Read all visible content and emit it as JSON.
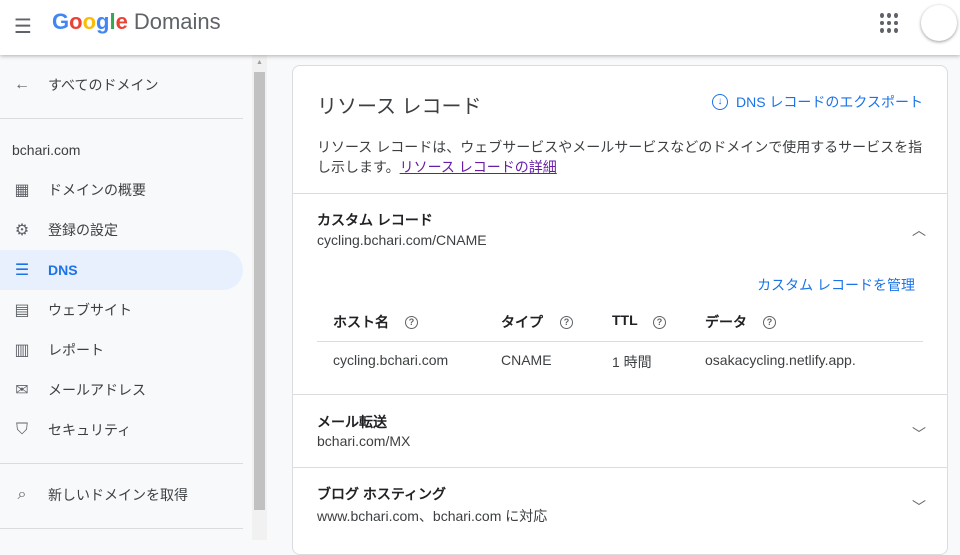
{
  "header": {
    "logo_google": "Google",
    "logo_product": "Domains"
  },
  "sidebar": {
    "back_label": "すべてのドメイン",
    "domain": "bchari.com",
    "items": [
      {
        "label": "ドメインの概要",
        "icon": "dashboard-icon"
      },
      {
        "label": "登録の設定",
        "icon": "gear-icon"
      },
      {
        "label": "DNS",
        "icon": "dns-icon"
      },
      {
        "label": "ウェブサイト",
        "icon": "website-icon"
      },
      {
        "label": "レポート",
        "icon": "chart-icon"
      },
      {
        "label": "メールアドレス",
        "icon": "mail-icon"
      },
      {
        "label": "セキュリティ",
        "icon": "shield-icon"
      }
    ],
    "get_domain_label": "新しいドメインを取得"
  },
  "card": {
    "title": "リソース レコード",
    "export_label": "DNS レコードのエクスポート",
    "description": "リソース レコードは、ウェブサービスやメールサービスなどのドメインで使用するサービスを指し示します。",
    "details_link": "リソース レコードの詳細",
    "sections": [
      {
        "title": "カスタム レコード",
        "subtitle": "cycling.bchari.com/CNAME",
        "manage_label": "カスタム レコードを管理",
        "columns": [
          "ホスト名",
          "タイプ",
          "TTL",
          "データ"
        ],
        "rows": [
          [
            "cycling.bchari.com",
            "CNAME",
            "1 時間",
            "osakacycling.netlify.app."
          ]
        ]
      },
      {
        "title": "メール転送",
        "subtitle": "bchari.com/MX"
      },
      {
        "title": "ブログ ホスティング",
        "subtitle": "www.bchari.com、bchari.com に対応"
      }
    ]
  }
}
